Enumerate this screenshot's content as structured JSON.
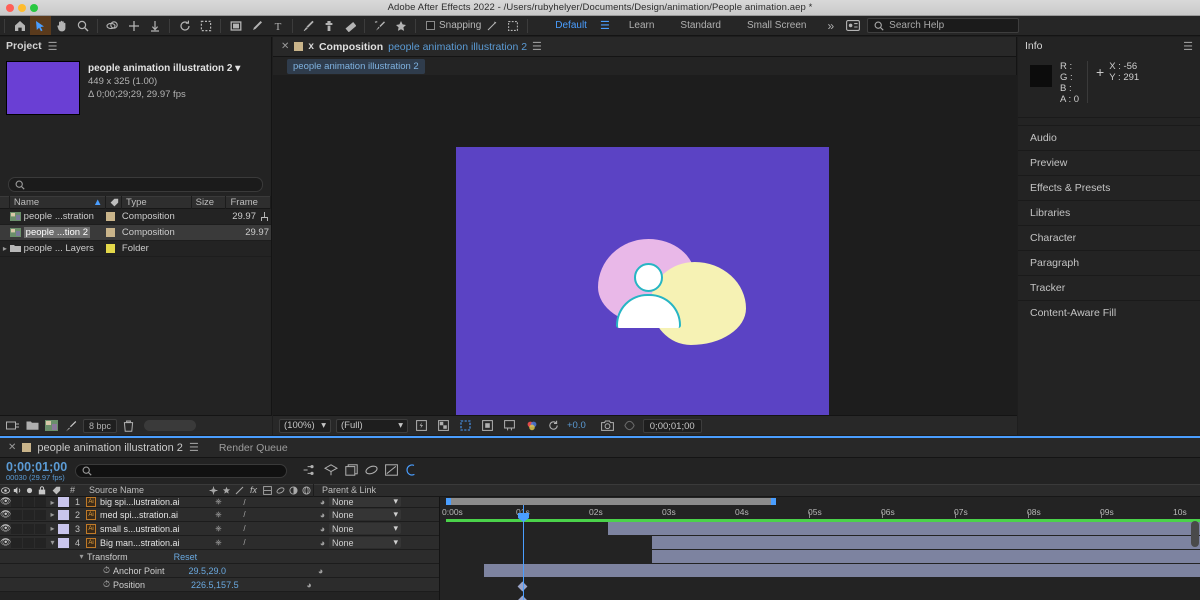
{
  "window": {
    "title": "Adobe After Effects 2022 - /Users/rubyhelyer/Documents/Design/animation/People animation.aep *"
  },
  "toolbar": {
    "snapping_label": "Snapping",
    "workspaces": [
      {
        "label": "Default",
        "selected": true
      },
      {
        "label": "Learn",
        "selected": false
      },
      {
        "label": "Standard",
        "selected": false
      },
      {
        "label": "Small Screen",
        "selected": false
      }
    ],
    "overflow_label": "»",
    "search_placeholder": "Search Help",
    "tools": [
      "home-icon",
      "selection-tool-icon",
      "hand-tool-icon",
      "zoom-tool-icon",
      "orbit-tool-icon",
      "pan-tool-icon",
      "dolly-tool-icon",
      "rotation-tool-icon",
      "region-of-interest-icon",
      "shape-tool-icon",
      "pen-tool-icon",
      "text-tool-icon",
      "brush-tool-icon",
      "clone-stamp-icon",
      "eraser-tool-icon",
      "roto-brush-icon",
      "puppet-pin-icon"
    ]
  },
  "project": {
    "title": "Project",
    "item_name": "people animation illustration 2",
    "dimensions": "449 x 325 (1.00)",
    "duration": "Δ 0;00;29;29, 29.97 fps",
    "search_placeholder": "",
    "columns": [
      "Name",
      "Type",
      "Size",
      "Frame Ra..."
    ],
    "assets": [
      {
        "name": "people ...stration",
        "type": "Composition",
        "size": "",
        "frame_rate": "29.97",
        "selected": false,
        "kind": "composition"
      },
      {
        "name": "people ...tion 2",
        "type": "Composition",
        "size": "",
        "frame_rate": "29.97",
        "selected": true,
        "kind": "composition"
      },
      {
        "name": "people ... Layers",
        "type": "Folder",
        "size": "",
        "frame_rate": "",
        "selected": false,
        "kind": "folder"
      }
    ],
    "bit_depth": "8 bpc"
  },
  "composition": {
    "tab_label": "Composition",
    "tab_name": "people animation illustration 2",
    "breadcrumb": "people animation illustration 2",
    "canvas_color": "#5b43c4",
    "controls": {
      "zoom": "(100%)",
      "resolution": "(Full)",
      "exposure": "+0.0",
      "timecode": "0;00;01;00"
    }
  },
  "info": {
    "title": "Info",
    "r_label": "R :",
    "g_label": "G :",
    "b_label": "B :",
    "a_label": "A :",
    "a_value": "0",
    "x_label": "X :",
    "x_value": "-56",
    "y_label": "Y :",
    "y_value": "291"
  },
  "dock_panels": [
    {
      "label": "Audio"
    },
    {
      "label": "Preview"
    },
    {
      "label": "Effects & Presets"
    },
    {
      "label": "Libraries"
    },
    {
      "label": "Character"
    },
    {
      "label": "Paragraph"
    },
    {
      "label": "Tracker"
    },
    {
      "label": "Content-Aware Fill"
    }
  ],
  "timeline": {
    "tab_name": "people animation illustration 2",
    "render_queue_label": "Render Queue",
    "current_time": "0;00;01;00",
    "current_frame": "00030 (29.97 fps)",
    "search_placeholder": "",
    "columns": {
      "source_name": "Source Name",
      "parent_link": "Parent & Link",
      "hash": "#"
    },
    "layers": [
      {
        "number": "1",
        "name": "big spi...lustration.ai",
        "parent": "None",
        "bar_start_pct": 22.0,
        "bar_end_pct": 100,
        "expanded": false
      },
      {
        "number": "2",
        "name": "med spi...stration.ai",
        "parent": "None",
        "bar_start_pct": 28.0,
        "bar_end_pct": 100,
        "expanded": false
      },
      {
        "number": "3",
        "name": "small s...ustration.ai",
        "parent": "None",
        "bar_start_pct": 28.0,
        "bar_end_pct": 100,
        "expanded": false
      },
      {
        "number": "4",
        "name": "Big man...stration.ai",
        "parent": "None",
        "bar_start_pct": 6.0,
        "bar_end_pct": 100,
        "expanded": true
      }
    ],
    "transform": {
      "label": "Transform",
      "reset_label": "Reset",
      "properties": [
        {
          "name": "Anchor Point",
          "value": "29.5,29.0"
        },
        {
          "name": "Position",
          "value": "226.5,157.5"
        }
      ]
    },
    "ruler_ticks": [
      "0:00s",
      "01s",
      "02s",
      "03s",
      "04s",
      "05s",
      "06s",
      "07s",
      "08s",
      "09s",
      "10s"
    ],
    "playhead_time_pct": 10.4,
    "work_area_end_pct": 43.5
  }
}
